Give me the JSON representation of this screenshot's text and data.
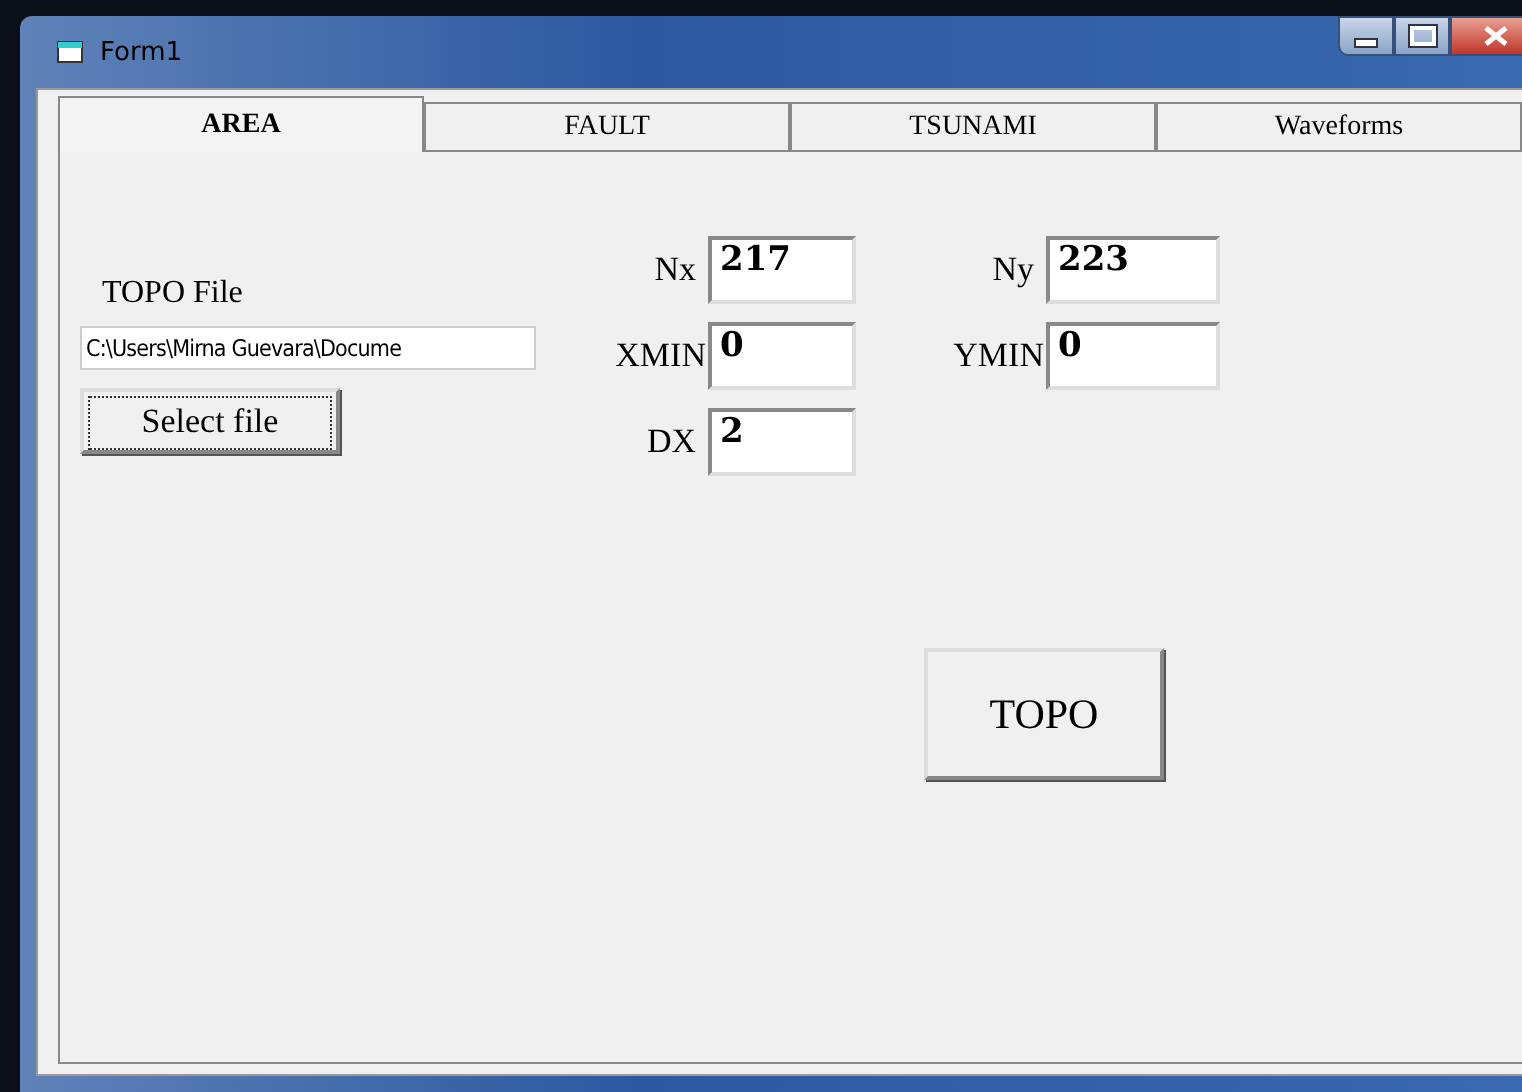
{
  "window": {
    "title": "Form1"
  },
  "tabs": [
    {
      "label": "AREA",
      "selected": true
    },
    {
      "label": "FAULT",
      "selected": false
    },
    {
      "label": "TSUNAMI",
      "selected": false
    },
    {
      "label": "Waveforms",
      "selected": false
    }
  ],
  "topo_file": {
    "label": "TOPO File",
    "value": "C:\\Users\\Mirna Guevara\\Docume",
    "button": "Select file"
  },
  "grid_fields_left": [
    {
      "label": "Nx",
      "value": "217"
    },
    {
      "label": "XMIN",
      "value": "0"
    },
    {
      "label": "DX",
      "value": "2"
    }
  ],
  "grid_fields_right": [
    {
      "label": "Ny",
      "value": "223"
    },
    {
      "label": "YMIN",
      "value": "0"
    }
  ],
  "topo_button": "TOPO"
}
